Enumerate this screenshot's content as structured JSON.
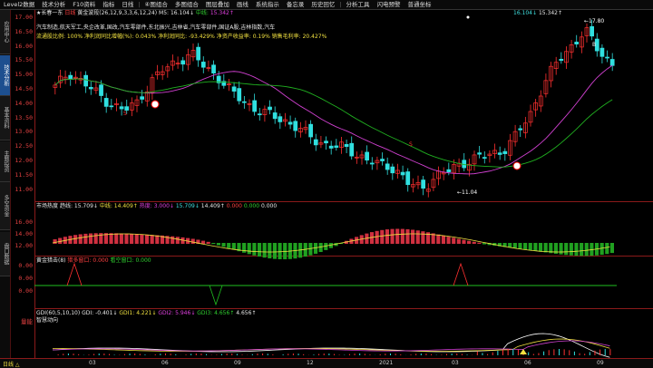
{
  "menubar": {
    "items": [
      "Level2数据",
      "技术分析",
      "F10资料",
      "指标",
      "日线",
      "|",
      "④图组合",
      "多图组合",
      "图层叠加",
      "画线",
      "系统指示",
      "备忘录",
      "历史回忆",
      "|",
      "分析工具",
      "闪电预警",
      "普通坐标"
    ]
  },
  "left_tabs": [
    "应用中心",
    "技术分析",
    "基本资料",
    "主题投资",
    "多空资金",
    "盘口数据"
  ],
  "price_info": {
    "stock": "★长春一东",
    "tag": "日线",
    "formula": "黄金波段(26,12,9,3,3,6,12,24)",
    "ma5_label": "M5:",
    "ma5_value": "16.104↓",
    "mid_label": "中线:",
    "mid_value": "15.342↑",
    "concepts": "汽车制造,航天军工,央企改革,国改,汽车零部件,东北振兴,吉林省,汽车零部件,国证A股,吉林指数,汽车",
    "stats": "流通股比例: 100%  净利润同比增幅(%): 0.043%  净利润同比: -93.429%  净资产收益率: 0.19%  销售毛利率: 20.427%"
  },
  "price_axis": [
    "17.00",
    "16.50",
    "16.00",
    "15.50",
    "15.00",
    "14.50",
    "14.00",
    "13.50",
    "13.00",
    "12.50",
    "12.00",
    "11.50",
    "11.00"
  ],
  "price_annotations": {
    "high": "17.80",
    "low": "11.04",
    "b_label": "B",
    "s_label": "S"
  },
  "top_right": {
    "v1": "16.104↓",
    "v2": "15.342↑"
  },
  "heat_info": {
    "name": "市场热度",
    "a_label": "趋线:",
    "a_value": "15.709↓",
    "b_label": "中线:",
    "b_value": "14.409↑",
    "c_label": "热度:",
    "c_value": "3.000↓",
    "d_value": "15.709↓",
    "e_value": "14.409↑",
    "f_value": "0.000",
    "g_value": "0.000",
    "h_value": "0.000"
  },
  "heat_axis": [
    "16.00",
    "14.00",
    "12.00"
  ],
  "gold_info": {
    "name": "黄金猎击(8)",
    "a_label": "猎多窗口:",
    "a_value": "0.000",
    "b_label": "看空窗口:",
    "b_value": "0.000"
  },
  "gold_axis": [
    "0.00",
    "0.00",
    "0.00"
  ],
  "gdi_info": {
    "name": "GDI(60,5,10,10)",
    "gdi_label": "GDI:",
    "gdi_value": "-0.401↓",
    "gdi1_label": "GDI1:",
    "gdi1_value": "4.221↓",
    "gdi2_label": "GDI2:",
    "gdi2_value": "5.946↓",
    "gdi3_label": "GDI3:",
    "gdi3_value": "4.656↑",
    "extra": "4.656↑",
    "sub": "智慧动向"
  },
  "gdi_axis": [
    "量能"
  ],
  "status": {
    "left": "日线 △",
    "dates": [
      "03",
      "06",
      "09",
      "12",
      "2021",
      "03",
      "06",
      "09"
    ]
  },
  "colors": {
    "up": "#ff3030",
    "down": "#30e0e0",
    "mid_line": "#20b020",
    "ma_line": "#d040d0",
    "accent": "#8b1a1a"
  }
}
